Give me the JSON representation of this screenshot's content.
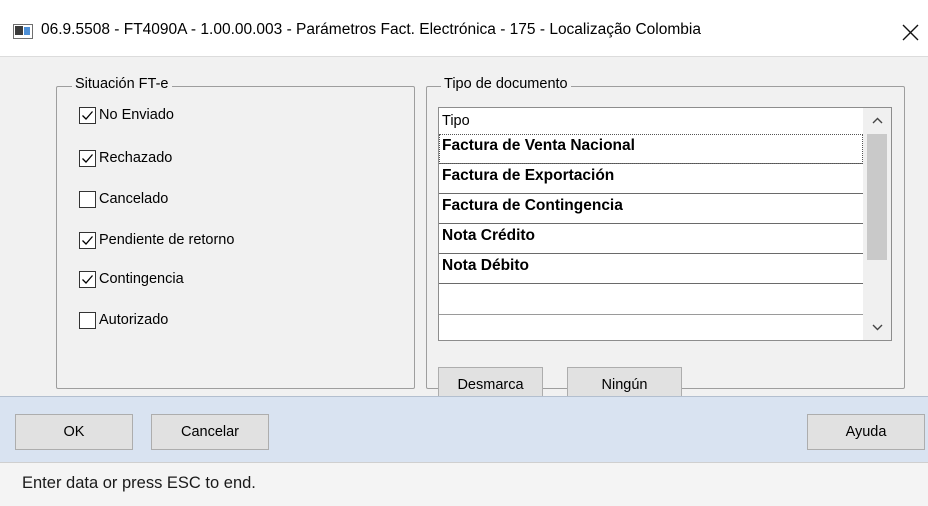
{
  "window": {
    "title": "06.9.5508 - FT4090A - 1.00.00.003 - Parámetros Fact. Electrónica - 175 - Localização Colombia",
    "icon": "app-window-icon",
    "close_icon": "close-icon"
  },
  "situacion": {
    "legend": "Situación FT-e",
    "options": [
      {
        "label": "No Enviado",
        "checked": true
      },
      {
        "label": "Rechazado",
        "checked": true
      },
      {
        "label": "Cancelado",
        "checked": false
      },
      {
        "label": "Pendiente de retorno",
        "checked": true
      },
      {
        "label": "Contingencia",
        "checked": true
      },
      {
        "label": "Autorizado",
        "checked": false
      }
    ]
  },
  "tipo_documento": {
    "legend": "Tipo de documento",
    "header": "Tipo",
    "items": [
      "Factura de Venta Nacional",
      "Factura de Exportación",
      "Factura de Contingencia",
      "Nota Crédito",
      "Nota Débito"
    ],
    "buttons": {
      "desmarca": "Desmarca",
      "ninguno": "Ningún"
    }
  },
  "footer": {
    "ok": "OK",
    "cancel": "Cancelar",
    "help": "Ayuda"
  },
  "status": "Enter data or press ESC to end.",
  "colors": {
    "panel": "#f1f1f1",
    "footer": "#d9e3f1",
    "button": "#e1e1e1",
    "check": "#000000"
  }
}
